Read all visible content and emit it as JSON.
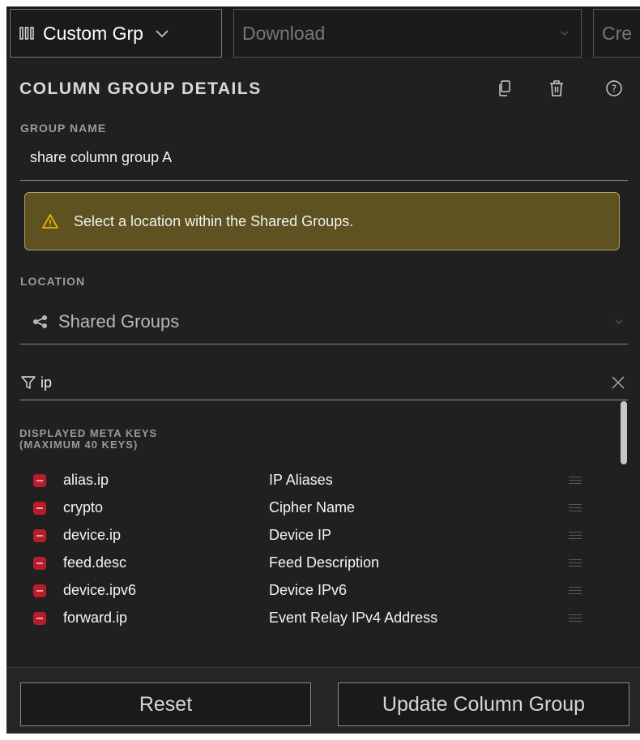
{
  "topbar": {
    "column_group_label": "Custom Grp",
    "download_label": "Download",
    "create_label": "Cre"
  },
  "panel": {
    "title": "COLUMN GROUP DETAILS",
    "icons": [
      "copy-icon",
      "trash-icon",
      "help-icon"
    ]
  },
  "group_name": {
    "label": "GROUP NAME",
    "value": "share column group A"
  },
  "warning": {
    "text": "Select a location within the Shared Groups."
  },
  "location": {
    "label": "LOCATION",
    "value": "Shared Groups"
  },
  "filter": {
    "value": "ip"
  },
  "displayed_keys": {
    "heading_line1": "DISPLAYED META KEYS",
    "heading_line2": "(MAXIMUM 40 KEYS)",
    "rows": [
      {
        "key": "alias.ip",
        "description": "IP Aliases"
      },
      {
        "key": "crypto",
        "description": "Cipher Name"
      },
      {
        "key": "device.ip",
        "description": "Device IP"
      },
      {
        "key": "feed.desc",
        "description": "Feed Description"
      },
      {
        "key": "device.ipv6",
        "description": "Device IPv6"
      },
      {
        "key": "forward.ip",
        "description": "Event Relay IPv4 Address"
      }
    ]
  },
  "footer": {
    "reset_label": "Reset",
    "update_label": "Update Column Group"
  },
  "colors": {
    "background": "#202020",
    "warning_bg": "#5e5220",
    "warning_icon": "#e8b400",
    "remove_icon": "#b91c2b"
  }
}
